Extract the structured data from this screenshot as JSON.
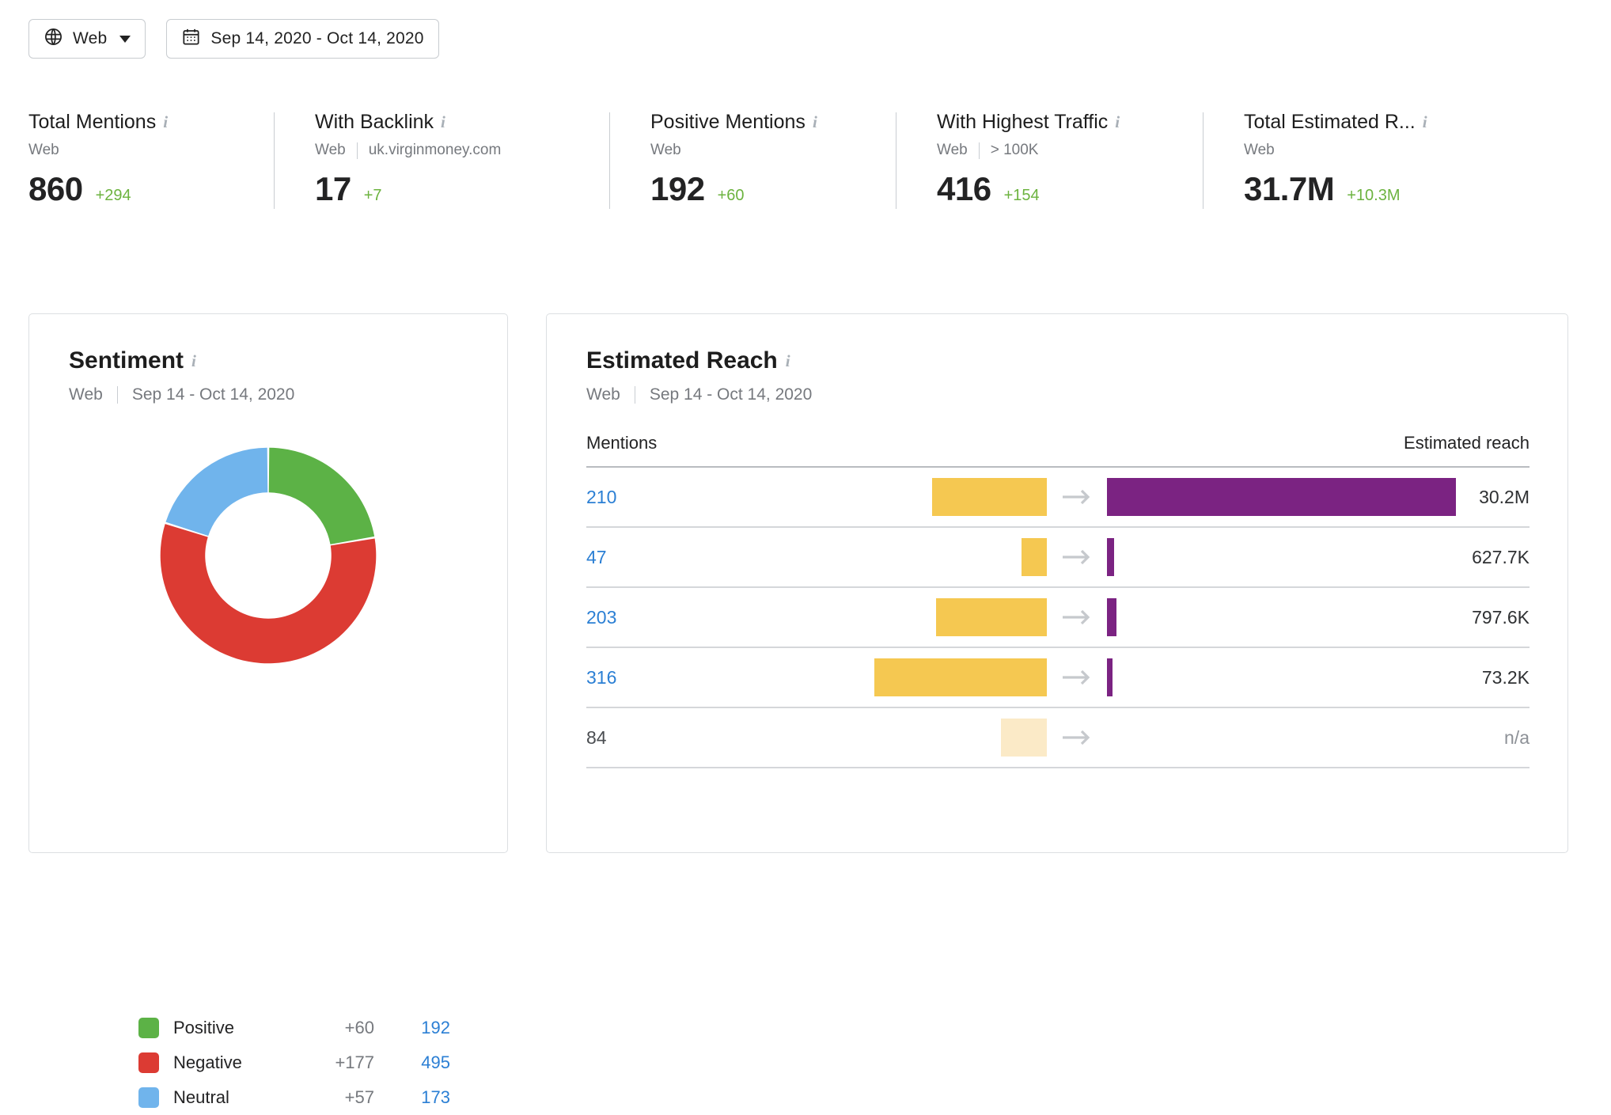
{
  "toolbar": {
    "source_button": {
      "label": "Web",
      "icon": "globe-icon",
      "chevron": "chevron-down-icon"
    },
    "date_button": {
      "label": "Sep 14, 2020 - Oct 14, 2020",
      "icon": "calendar-icon"
    }
  },
  "kpis": [
    {
      "title": "Total Mentions",
      "source": "Web",
      "filter": "",
      "value": "860",
      "delta": "+294"
    },
    {
      "title": "With Backlink",
      "source": "Web",
      "filter": "uk.virginmoney.com",
      "value": "17",
      "delta": "+7"
    },
    {
      "title": "Positive Mentions",
      "source": "Web",
      "filter": "",
      "value": "192",
      "delta": "+60"
    },
    {
      "title": "With Highest Traffic",
      "source": "Web",
      "filter": "> 100K",
      "value": "416",
      "delta": "+154"
    },
    {
      "title": "Total Estimated R...",
      "source": "Web",
      "filter": "",
      "value": "31.7M",
      "delta": "+10.3M"
    }
  ],
  "sentiment": {
    "title": "Sentiment",
    "source": "Web",
    "period": "Sep 14 - Oct 14, 2020",
    "legend": [
      {
        "label": "Positive",
        "delta": "+60",
        "value": "192",
        "color": "#5cb246"
      },
      {
        "label": "Negative",
        "delta": "+177",
        "value": "495",
        "color": "#dc3b33"
      },
      {
        "label": "Neutral",
        "delta": "+57",
        "value": "173",
        "color": "#70b4ec"
      }
    ]
  },
  "reach": {
    "title": "Estimated Reach",
    "source": "Web",
    "period": "Sep 14 - Oct 14, 2020",
    "columns": {
      "left": "Mentions",
      "right": "Estimated reach"
    },
    "rows": [
      {
        "mentions": "210",
        "reach": "30.2M",
        "mentions_is_link": true,
        "reach_na": false
      },
      {
        "mentions": "47",
        "reach": "627.7K",
        "mentions_is_link": true,
        "reach_na": false
      },
      {
        "mentions": "203",
        "reach": "797.6K",
        "mentions_is_link": true,
        "reach_na": false
      },
      {
        "mentions": "316",
        "reach": "73.2K",
        "mentions_is_link": true,
        "reach_na": false
      },
      {
        "mentions": "84",
        "reach": "n/a",
        "mentions_is_link": false,
        "reach_na": true
      }
    ]
  },
  "chart_data": [
    {
      "type": "pie",
      "title": "Sentiment",
      "subtitle": "Web | Sep 14 - Oct 14, 2020",
      "donut": true,
      "labels": [
        "Positive",
        "Negative",
        "Neutral"
      ],
      "values": [
        192,
        495,
        173
      ],
      "deltas": [
        "+60",
        "+177",
        "+57"
      ],
      "colors": [
        "#5cb246",
        "#dc3b33",
        "#70b4ec"
      ],
      "total": 860,
      "legend_position": "bottom-left",
      "start_angle_deg": 0,
      "direction": "clockwise"
    },
    {
      "type": "bar",
      "title": "Estimated Reach",
      "subtitle": "Web | Sep 14 - Oct 14, 2020",
      "orientation": "horizontal",
      "xlabel": "",
      "ylabel": "",
      "grid": false,
      "legend_position": "none",
      "categories": [
        "row-1",
        "row-2",
        "row-3",
        "row-4",
        "row-5"
      ],
      "series": [
        {
          "name": "Mentions",
          "color": "#f5c851",
          "align": "right",
          "values": [
            210,
            47,
            203,
            316,
            84
          ],
          "labels": [
            "210",
            "47",
            "203",
            "316",
            "84"
          ]
        },
        {
          "name": "Estimated reach",
          "color": "#7b2382",
          "align": "left",
          "values": [
            30200000,
            627700,
            797600,
            73200,
            null
          ],
          "labels": [
            "30.2M",
            "627.7K",
            "797.6K",
            "73.2K",
            "n/a"
          ]
        }
      ],
      "annotations": [
        "arrow-between-bars"
      ]
    }
  ],
  "colors": {
    "positive": "#5cb246",
    "negative": "#dc3b33",
    "neutral": "#70b4ec",
    "mentions_bar": "#f5c851",
    "mentions_bar_muted": "#fbeac7",
    "reach_bar": "#7b2382",
    "link": "#2b7fd4",
    "delta_positive": "#6cb33f"
  }
}
